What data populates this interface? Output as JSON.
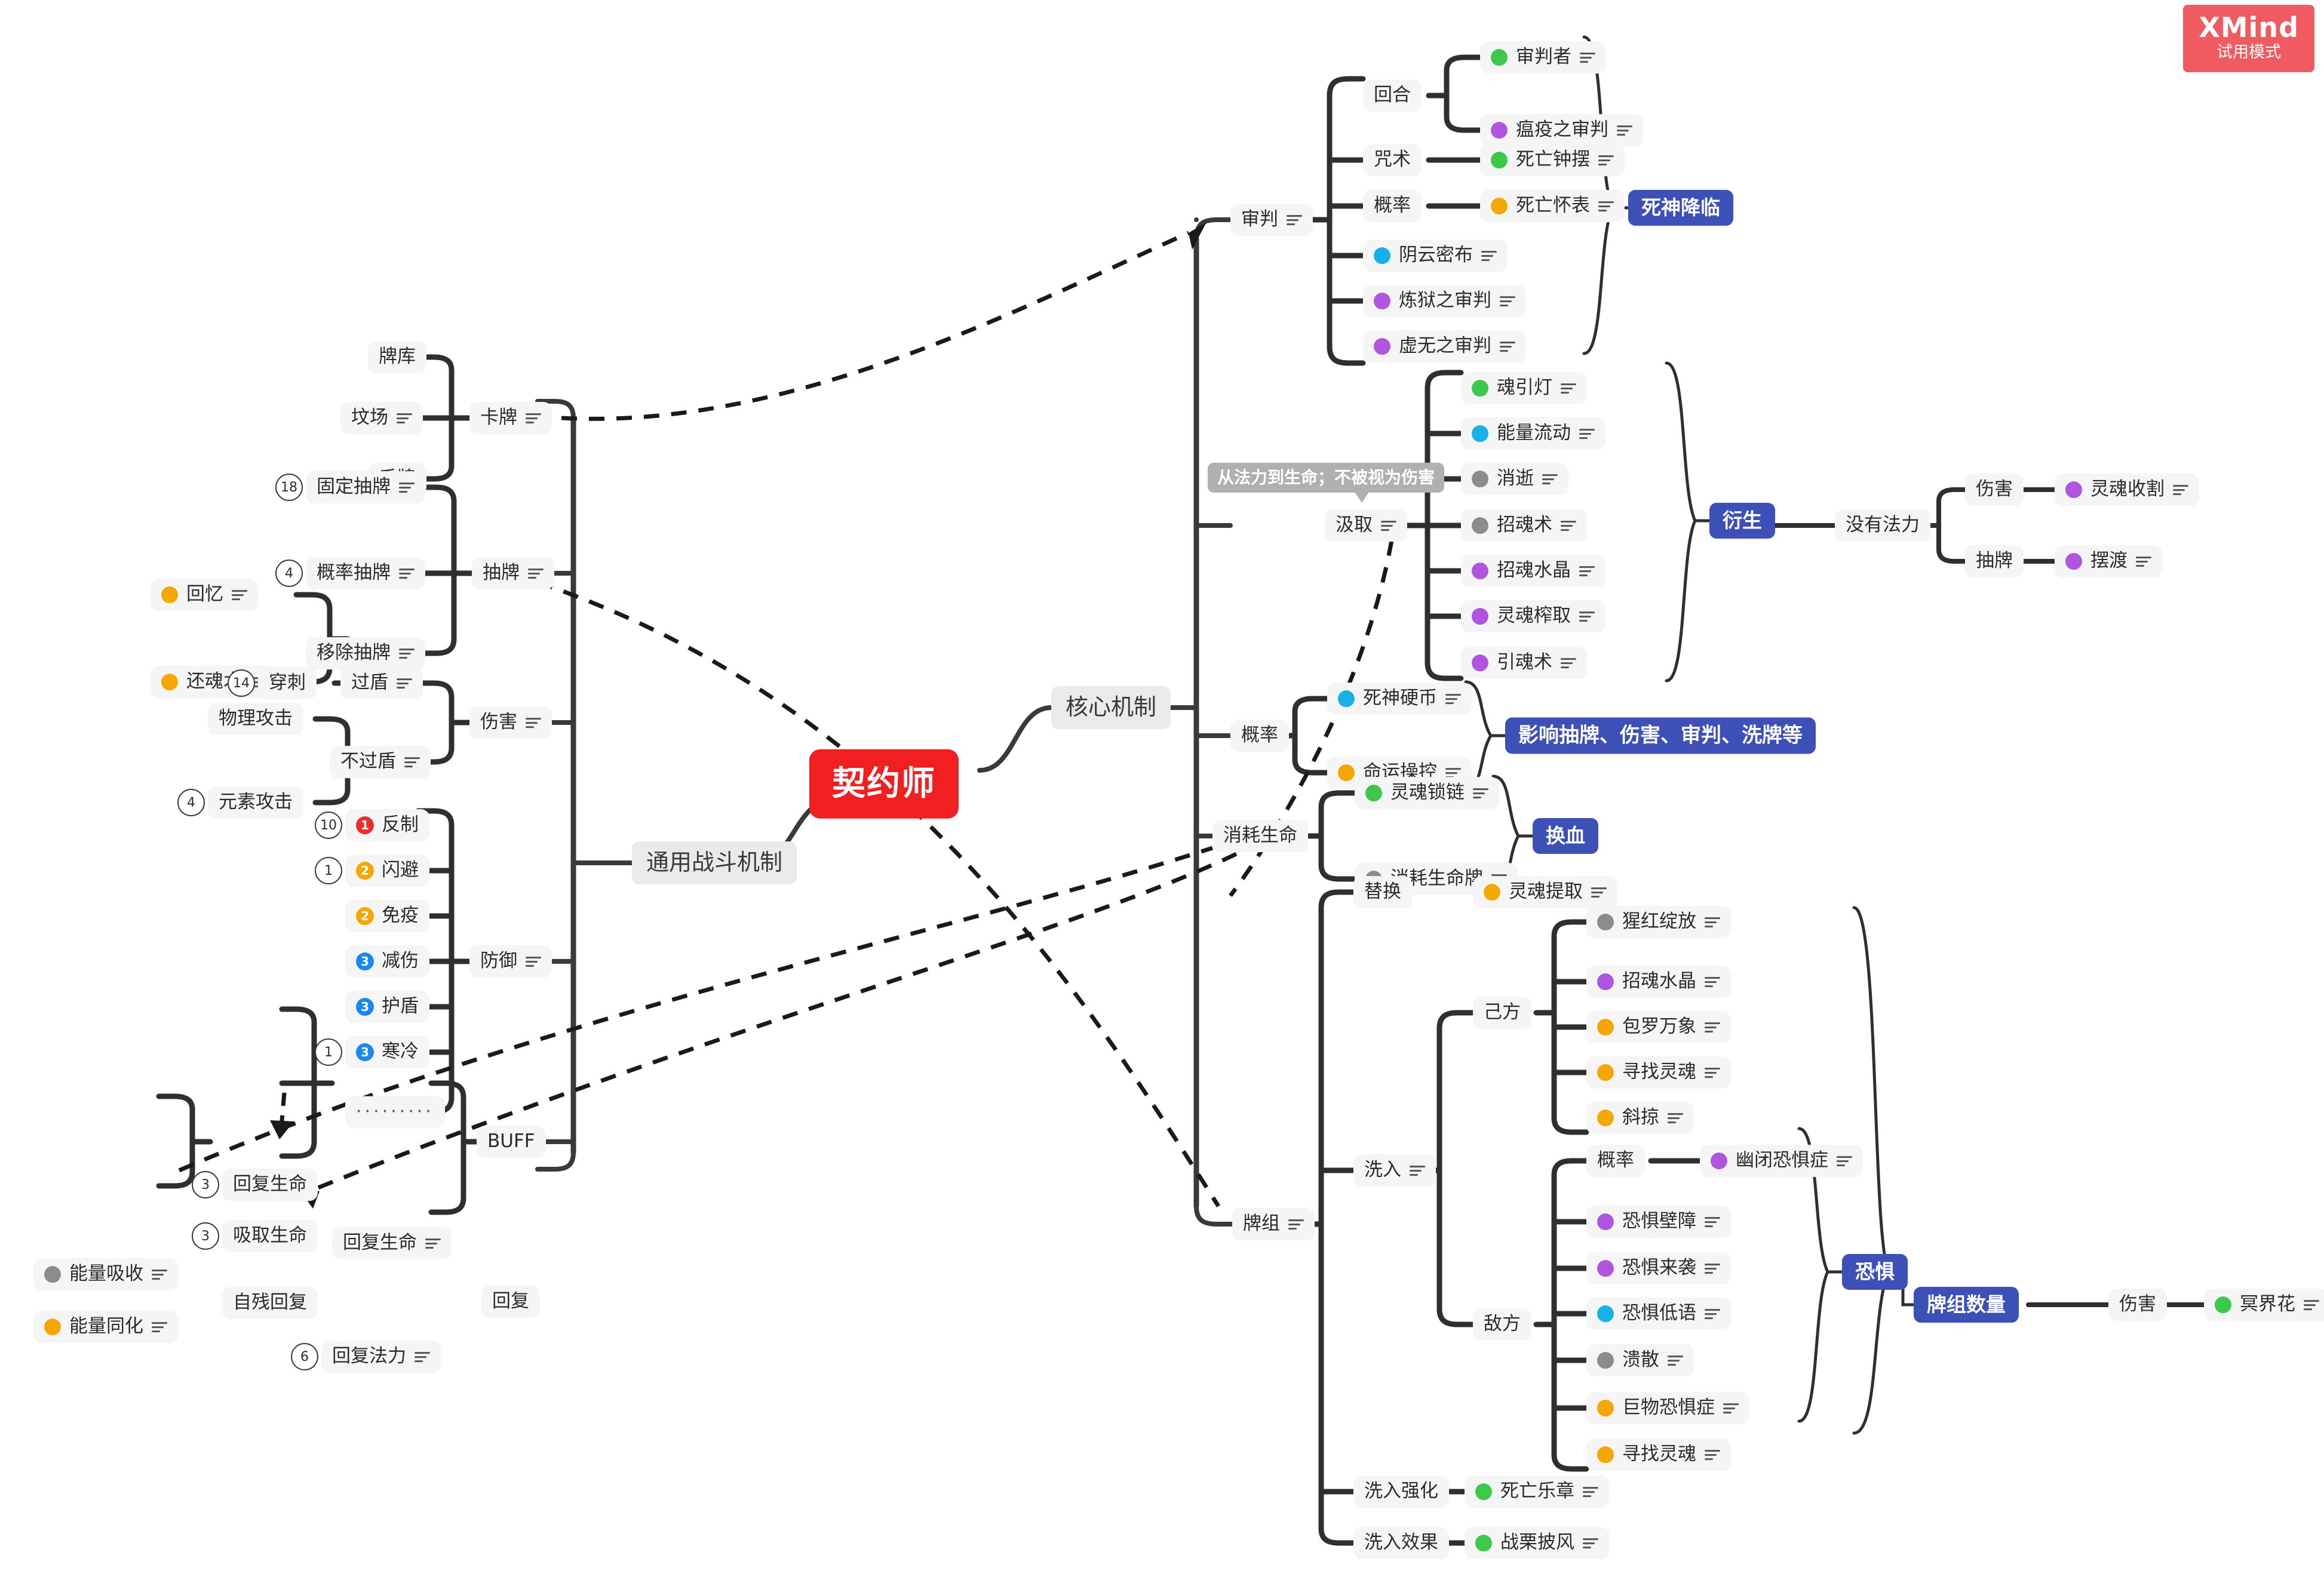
{
  "watermark": {
    "brand": "XMind",
    "mode": "试用模式",
    "color": "#ef5b60"
  },
  "colors": {
    "central": "#f21f21",
    "callout": "#3d50b8",
    "branch": "#eaeaea",
    "node": "#f5f5f5",
    "balloon": "#b0b0b0",
    "green": "#3cc84a",
    "purple": "#b055e0",
    "blue": "#17b0e8",
    "orange": "#f5a600",
    "grey": "#8c8c8c",
    "red": "#ee2b2b"
  },
  "central_topic": "契约师",
  "branches": {
    "core": "核心机制",
    "general_combat": "通用战斗机制"
  },
  "notes": {
    "extract_balloon": "从法力到生命；不被视为伤害"
  },
  "callouts": {
    "death_advent": "死神降临",
    "derive": "衍生",
    "probability_effect": "影响抽牌、伤害、审判、洗牌等",
    "blood_swap": "换血",
    "fear": "恐惧",
    "deck_count": "牌组数量"
  },
  "left": {
    "cards": {
      "label": "卡牌",
      "children": [
        "牌库",
        "坟场",
        "手牌"
      ]
    },
    "draw": {
      "label": "抽牌",
      "children": [
        {
          "label": "固定抽牌",
          "count": "18"
        },
        {
          "label": "概率抽牌",
          "count": "4"
        },
        {
          "label": "移除抽牌",
          "count": ""
        }
      ],
      "remove_children": [
        {
          "label": "回忆",
          "dot": "orange"
        },
        {
          "label": "还魂术",
          "dot": "orange"
        }
      ]
    },
    "damage": {
      "label": "伤害",
      "pierce": {
        "label": "穿刺",
        "count": "14"
      },
      "through_shield": "过盾",
      "not_through_shield": "不过盾",
      "physical": "物理攻击",
      "elemental": {
        "label": "元素攻击",
        "count": "4"
      }
    },
    "defense": {
      "label": "防御",
      "children": [
        {
          "label": "反制",
          "pri": "1",
          "pri_color": "red",
          "count": "10"
        },
        {
          "label": "闪避",
          "pri": "2",
          "pri_color": "orange",
          "count": "1"
        },
        {
          "label": "免疫",
          "pri": "2",
          "pri_color": "orange",
          "count": ""
        },
        {
          "label": "减伤",
          "pri": "3",
          "pri_color": "blue",
          "count": ""
        },
        {
          "label": "护盾",
          "pri": "3",
          "pri_color": "blue",
          "count": ""
        },
        {
          "label": "寒冷",
          "pri": "3",
          "pri_color": "blue",
          "count": "1"
        },
        {
          "label": "·········",
          "pri": "",
          "pri_color": "",
          "count": ""
        }
      ]
    },
    "buff": "BUFF",
    "recover": {
      "label": "回复",
      "recover_life": {
        "label": "回复生命",
        "children": [
          {
            "label": "回复生命",
            "count": "3"
          },
          {
            "label": "吸取生命",
            "count": "3"
          },
          {
            "label": "自残回复",
            "count": ""
          }
        ],
        "self_harm_children": [
          {
            "label": "能量吸收",
            "dot": "grey"
          },
          {
            "label": "能量同化",
            "dot": "orange"
          }
        ]
      },
      "recover_mana": {
        "label": "回复法力",
        "count": "6"
      }
    }
  },
  "right": {
    "judgement": {
      "label": "审判",
      "turn": {
        "label": "回合",
        "children": [
          {
            "label": "审判者",
            "dot": "green"
          },
          {
            "label": "瘟疫之审判",
            "dot": "purple"
          }
        ]
      },
      "curse": {
        "label": "咒术",
        "child": {
          "label": "死亡钟摆",
          "dot": "green"
        }
      },
      "probability": {
        "label": "概率",
        "child": {
          "label": "死亡怀表",
          "dot": "orange"
        }
      },
      "direct": [
        {
          "label": "阴云密布",
          "dot": "blue"
        },
        {
          "label": "炼狱之审判",
          "dot": "purple"
        },
        {
          "label": "虚无之审判",
          "dot": "purple"
        }
      ]
    },
    "extract": {
      "label": "汲取",
      "children": [
        {
          "label": "魂引灯",
          "dot": "green"
        },
        {
          "label": "能量流动",
          "dot": "blue"
        },
        {
          "label": "消逝",
          "dot": "grey"
        },
        {
          "label": "招魂术",
          "dot": "grey"
        },
        {
          "label": "招魂水晶",
          "dot": "purple"
        },
        {
          "label": "灵魂榨取",
          "dot": "purple"
        },
        {
          "label": "引魂术",
          "dot": "purple"
        }
      ],
      "no_mana": {
        "label": "没有法力",
        "children": [
          {
            "label": "伤害",
            "child": {
              "label": "灵魂收割",
              "dot": "purple"
            }
          },
          {
            "label": "抽牌",
            "child": {
              "label": "摆渡",
              "dot": "purple"
            }
          }
        ]
      }
    },
    "probability": {
      "label": "概率",
      "children": [
        {
          "label": "死神硬币",
          "dot": "blue"
        },
        {
          "label": "命运操控",
          "dot": "orange"
        }
      ]
    },
    "consume_life": {
      "label": "消耗生命",
      "children": [
        {
          "label": "灵魂锁链",
          "dot": "green"
        },
        {
          "label": "消耗生命牌",
          "dot": "grey"
        }
      ]
    },
    "deck": {
      "label": "牌组",
      "replace": {
        "label": "替换",
        "child": {
          "label": "灵魂提取",
          "dot": "orange"
        }
      },
      "shuffle_in": {
        "label": "洗入",
        "own": {
          "label": "己方",
          "children": [
            {
              "label": "猩红绽放",
              "dot": "grey"
            },
            {
              "label": "招魂水晶",
              "dot": "purple"
            },
            {
              "label": "包罗万象",
              "dot": "orange"
            },
            {
              "label": "寻找灵魂",
              "dot": "orange"
            },
            {
              "label": "斜掠",
              "dot": "orange"
            }
          ]
        },
        "enemy": {
          "label": "敌方",
          "probability": {
            "label": "概率",
            "child": {
              "label": "幽闭恐惧症",
              "dot": "purple"
            }
          },
          "children": [
            {
              "label": "恐惧壁障",
              "dot": "purple"
            },
            {
              "label": "恐惧来袭",
              "dot": "purple"
            },
            {
              "label": "恐惧低语",
              "dot": "blue"
            },
            {
              "label": "溃散",
              "dot": "grey"
            },
            {
              "label": "巨物恐惧症",
              "dot": "orange"
            },
            {
              "label": "寻找灵魂",
              "dot": "orange"
            }
          ]
        }
      },
      "shuffle_enhance": {
        "label": "洗入强化",
        "child": {
          "label": "死亡乐章",
          "dot": "green"
        }
      },
      "shuffle_effect": {
        "label": "洗入效果",
        "child": {
          "label": "战栗披风",
          "dot": "green"
        }
      }
    },
    "deck_count_branch": {
      "damage": "伤害",
      "child": {
        "label": "冥界花",
        "dot": "green"
      }
    }
  }
}
